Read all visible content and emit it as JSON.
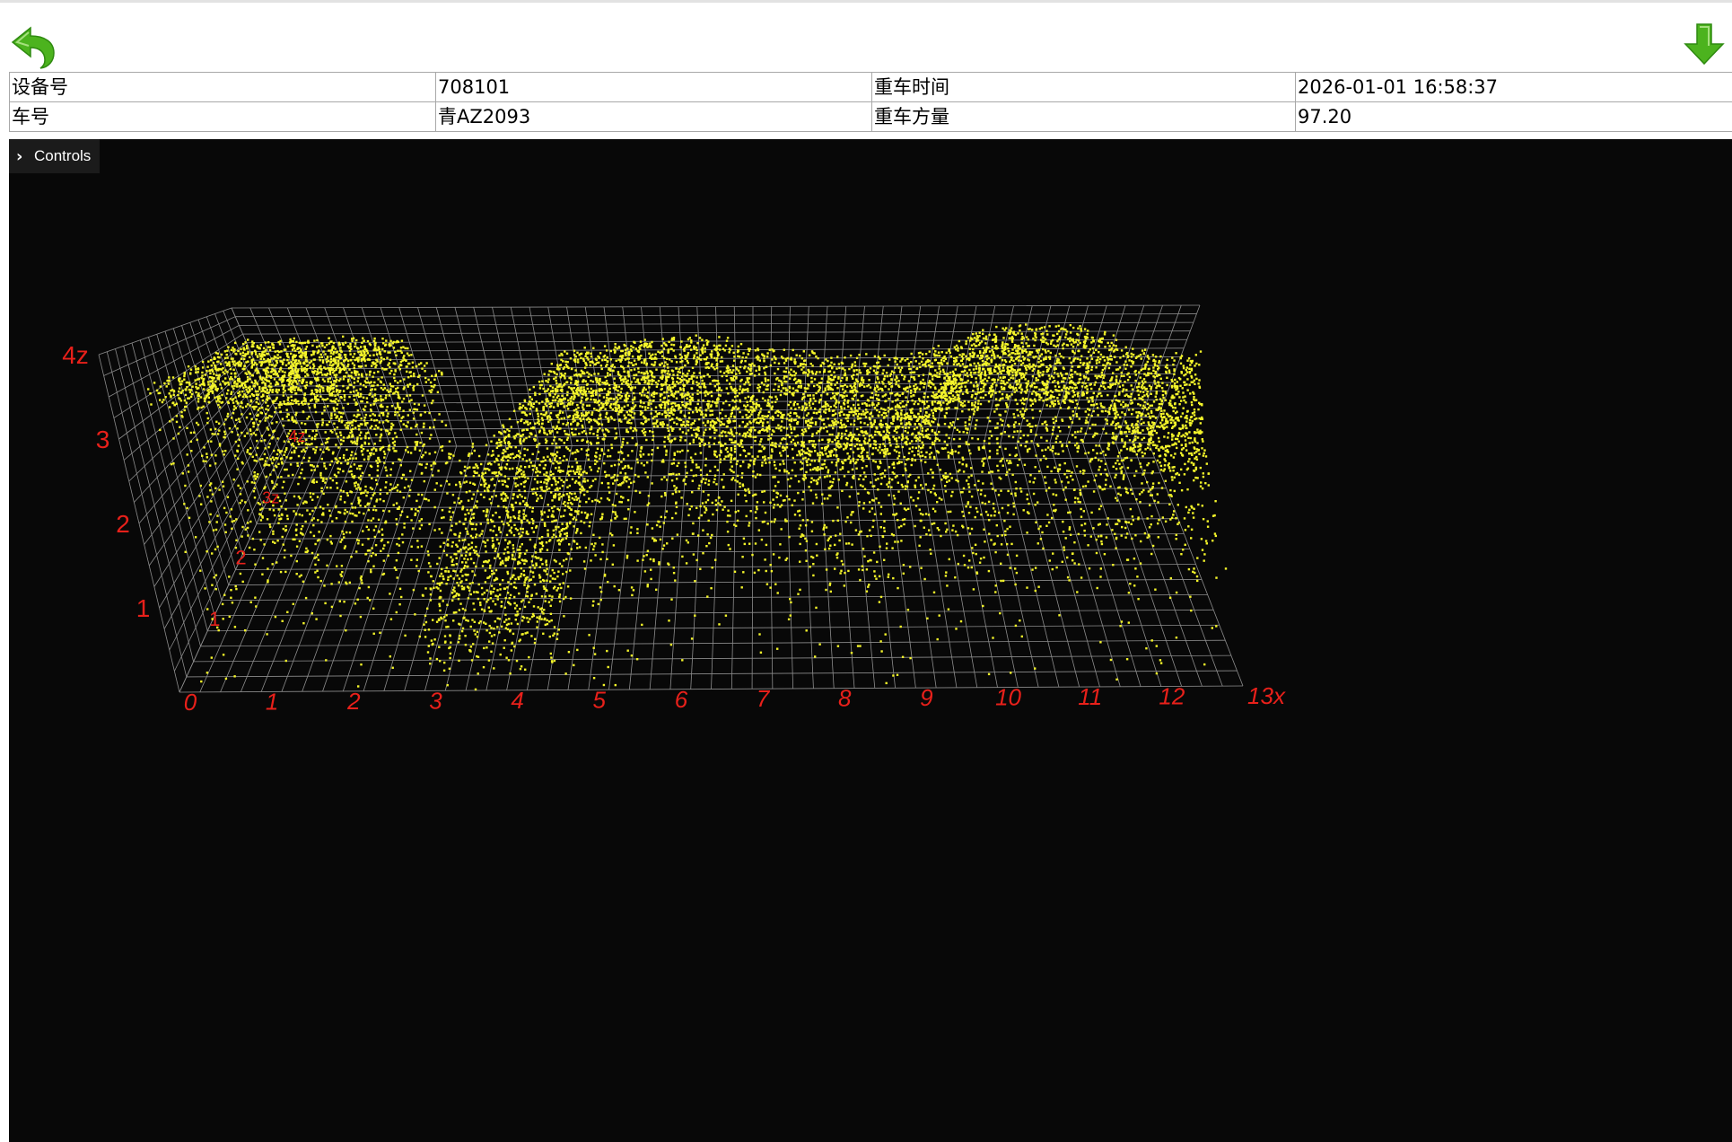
{
  "colors": {
    "accent_green": "#4cb31e",
    "point_color": "#f4f52a",
    "axis_label_color": "#e8201a",
    "grid_color": "#8c8c8c",
    "viewer_background": "#080808"
  },
  "toolbar": {
    "back_icon": "undo-arrow-icon",
    "download_icon": "down-arrow-icon"
  },
  "info": {
    "device_label": "设备号",
    "device_value": "708101",
    "time_label": "重车时间",
    "time_value": "2026-01-01 16:58:37",
    "plate_label": "车号",
    "plate_value": "青AZ2093",
    "volume_label": "重车方量",
    "volume_value": "97.20"
  },
  "viewer": {
    "controls_label": "Controls",
    "controls_icon": "chevron-right-icon"
  },
  "chart_data": {
    "type": "scatter",
    "dimensions": 3,
    "x_ticks": [
      "0",
      "1",
      "2",
      "3",
      "4",
      "5",
      "6",
      "7",
      "8",
      "9",
      "10",
      "11",
      "12",
      "13x"
    ],
    "y_ticks": [
      "1",
      "2",
      "3z",
      "4z"
    ],
    "z_ticks": [
      "1",
      "2",
      "3",
      "4z"
    ],
    "xlim": [
      0,
      13
    ],
    "ylim": [
      0,
      4
    ],
    "zlim": [
      0,
      4
    ],
    "grid": true,
    "description": "truck point cloud: cab near x 0.5-3, empty bed x 3-4.5, loaded trailer x 4.5-13 with peak height about 3.5"
  }
}
